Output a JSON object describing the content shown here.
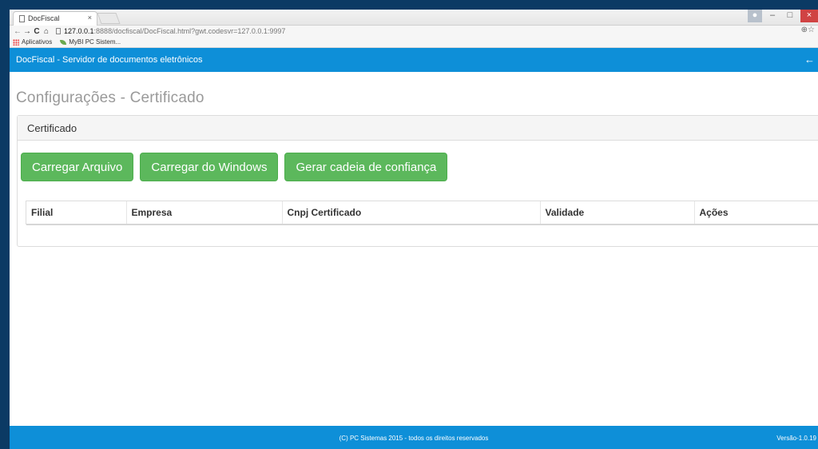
{
  "browser": {
    "tab_title": "DocFiscal",
    "tab_close": "×",
    "window_controls": {
      "minimize": "–",
      "maximize": "□",
      "close": "×"
    },
    "nav": {
      "back": "←",
      "forward": "→",
      "reload": "C",
      "home": "⌂"
    },
    "url_host": "127.0.0.1",
    "url_rest": ":8888/docfiscal/DocFiscal.html?gwt.codesvr=127.0.0.1:9997",
    "bookmarks": [
      {
        "label": "Aplicativos"
      },
      {
        "label": "MyBI PC Sistem..."
      }
    ]
  },
  "app": {
    "header_title": "DocFiscal - Servidor de documentos eletrônicos",
    "back_icon": "←"
  },
  "page": {
    "title": "Configurações - Certificado"
  },
  "panel": {
    "heading": "Certificado",
    "buttons": [
      {
        "label": "Carregar Arquivo"
      },
      {
        "label": "Carregar do Windows"
      },
      {
        "label": "Gerar cadeia de confiança"
      }
    ],
    "table": {
      "columns": [
        "Filial",
        "Empresa",
        "Cnpj Certificado",
        "Validade",
        "Ações"
      ]
    }
  },
  "footer": {
    "copyright": "(C) PC Sistemas 2015 - todos os direitos reservados",
    "version": "Versão-1.0.19"
  },
  "colors": {
    "header_bg": "#0e8fd8",
    "button_green": "#5cb85c",
    "title_gray": "#9a9a9a"
  }
}
